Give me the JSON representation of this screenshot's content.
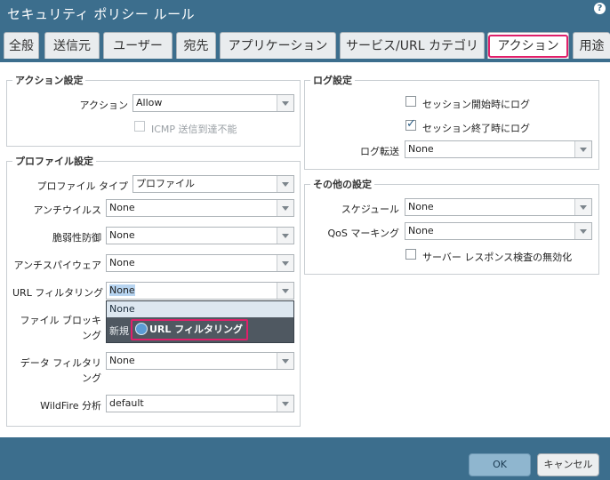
{
  "window": {
    "title": "セキュリティ ポリシー ルール"
  },
  "tabs": [
    {
      "label": "全般"
    },
    {
      "label": "送信元"
    },
    {
      "label": "ユーザー"
    },
    {
      "label": "宛先"
    },
    {
      "label": "アプリケーション"
    },
    {
      "label": "サービス/URL カテゴリ"
    },
    {
      "label": "アクション",
      "active": true
    },
    {
      "label": "用途"
    }
  ],
  "action_settings": {
    "legend": "アクション設定",
    "action_label": "アクション",
    "action_value": "Allow",
    "icmp_label": "ICMP 送信到達不能",
    "icmp_checked": false
  },
  "log_settings": {
    "legend": "ログ設定",
    "log_start_label": "セッション開始時にログ",
    "log_start_checked": false,
    "log_end_label": "セッション終了時にログ",
    "log_end_checked": true,
    "forward_label": "ログ転送",
    "forward_value": "None"
  },
  "profile_settings": {
    "legend": "プロファイル設定",
    "profile_type_label": "プロファイル タイプ",
    "profile_type_value": "プロファイル",
    "antivirus_label": "アンチウイルス",
    "antivirus_value": "None",
    "vuln_label": "脆弱性防御",
    "vuln_value": "None",
    "antispyware_label": "アンチスパイウェア",
    "antispyware_value": "None",
    "url_label": "URL フィルタリング",
    "url_value": "None",
    "file_block_label_1": "ファイル ブロッキ",
    "file_block_label_2": "ング",
    "data_filter_label_1": "データ フィルタリ",
    "data_filter_label_2": "ング",
    "data_filter_value": "None",
    "wildfire_label": "WildFire 分析",
    "wildfire_value": "default"
  },
  "url_dropdown": {
    "option_none": "None",
    "new_label": "新規",
    "new_item_label": "URL フィルタリング"
  },
  "other_settings": {
    "legend": "その他の設定",
    "schedule_label": "スケジュール",
    "schedule_value": "None",
    "qos_label": "QoS マーキング",
    "qos_value": "None",
    "disable_srv_label": "サーバー レスポンス検査の無効化",
    "disable_srv_checked": false
  },
  "buttons": {
    "ok": "OK",
    "cancel": "キャンセル"
  },
  "colors": {
    "header": "#3c6e8d",
    "highlight": "#e0206b"
  }
}
